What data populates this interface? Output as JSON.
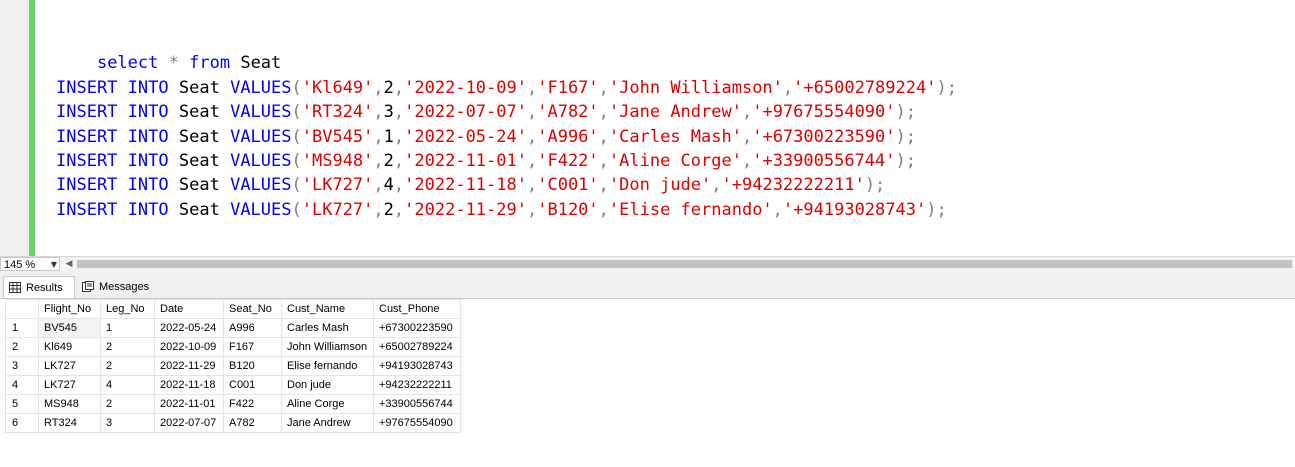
{
  "editor": {
    "select_line": [
      "select",
      "*",
      "from",
      "Seat"
    ],
    "inserts": [
      {
        "flight": "'Kl649'",
        "leg": "2",
        "date": "'2022-10-09'",
        "seat": "'F167'",
        "name": "'John Williamson'",
        "phone": "'+65002789224'"
      },
      {
        "flight": "'RT324'",
        "leg": "3",
        "date": "'2022-07-07'",
        "seat": "'A782'",
        "name": "'Jane Andrew'",
        "phone": "'+97675554090'"
      },
      {
        "flight": "'BV545'",
        "leg": "1",
        "date": "'2022-05-24'",
        "seat": "'A996'",
        "name": "'Carles Mash'",
        "phone": "'+67300223590'"
      },
      {
        "flight": "'MS948'",
        "leg": "2",
        "date": "'2022-11-01'",
        "seat": "'F422'",
        "name": "'Aline Corge'",
        "phone": "'+33900556744'"
      },
      {
        "flight": "'LK727'",
        "leg": "4",
        "date": "'2022-11-18'",
        "seat": "'C001'",
        "name": "'Don jude'",
        "phone": "'+94232222211'"
      },
      {
        "flight": "'LK727'",
        "leg": "2",
        "date": "'2022-11-29'",
        "seat": "'B120'",
        "name": "'Elise fernando'",
        "phone": "'+94193028743'"
      }
    ],
    "insert_keywords": {
      "insert": "INSERT",
      "into": "INTO",
      "table": "Seat",
      "values": "VALUES"
    }
  },
  "zoom": {
    "value": "145 %"
  },
  "tabs": [
    {
      "label": "Results",
      "icon": "grid-icon",
      "active": true
    },
    {
      "label": "Messages",
      "icon": "messages-icon",
      "active": false
    }
  ],
  "results": {
    "columns": [
      "Flight_No",
      "Leg_No",
      "Date",
      "Seat_No",
      "Cust_Name",
      "Cust_Phone"
    ],
    "rows": [
      {
        "n": "1",
        "cells": [
          "BV545",
          "1",
          "2022-05-24",
          "A996",
          "Carles Mash",
          "+67300223590"
        ]
      },
      {
        "n": "2",
        "cells": [
          "Kl649",
          "2",
          "2022-10-09",
          "F167",
          "John Williamson",
          "+65002789224"
        ]
      },
      {
        "n": "3",
        "cells": [
          "LK727",
          "2",
          "2022-11-29",
          "B120",
          "Elise fernando",
          "+94193028743"
        ]
      },
      {
        "n": "4",
        "cells": [
          "LK727",
          "4",
          "2022-11-18",
          "C001",
          "Don jude",
          "+94232222211"
        ]
      },
      {
        "n": "5",
        "cells": [
          "MS948",
          "2",
          "2022-11-01",
          "F422",
          "Aline Corge",
          "+33900556744"
        ]
      },
      {
        "n": "6",
        "cells": [
          "RT324",
          "3",
          "2022-07-07",
          "A782",
          "Jane Andrew",
          "+97675554090"
        ]
      }
    ]
  },
  "colors": {
    "keyword": "#0000ff",
    "string": "#e00000",
    "change_bar": "#6ad361"
  }
}
